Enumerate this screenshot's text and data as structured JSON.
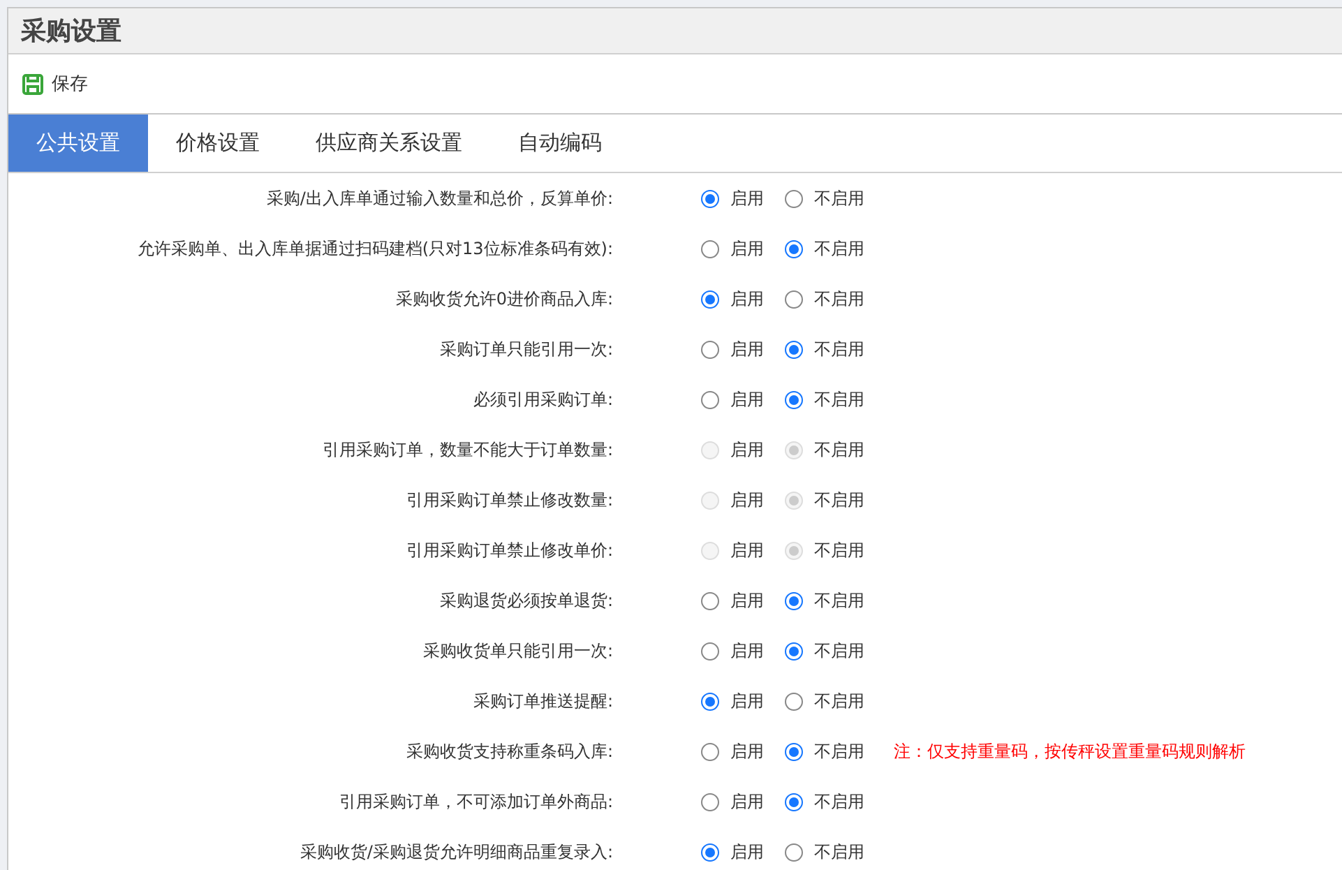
{
  "page": {
    "title": "采购设置"
  },
  "toolbar": {
    "save_label": "保存"
  },
  "tabs": [
    {
      "label": "公共设置",
      "selected": true
    },
    {
      "label": "价格设置",
      "selected": false
    },
    {
      "label": "供应商关系设置",
      "selected": false
    },
    {
      "label": "自动编码",
      "selected": false
    }
  ],
  "settings": [
    {
      "label": "采购/出入库单通过输入数量和总价，反算单价:",
      "disabled": false,
      "options": [
        {
          "label": "启用",
          "selected": true
        },
        {
          "label": "不启用",
          "selected": false
        }
      ]
    },
    {
      "label": "允许采购单、出入库单据通过扫码建档(只对13位标准条码有效):",
      "disabled": false,
      "options": [
        {
          "label": "启用",
          "selected": false
        },
        {
          "label": "不启用",
          "selected": true
        }
      ]
    },
    {
      "label": "采购收货允许0进价商品入库:",
      "disabled": false,
      "options": [
        {
          "label": "启用",
          "selected": true
        },
        {
          "label": "不启用",
          "selected": false
        }
      ]
    },
    {
      "label": "采购订单只能引用一次:",
      "disabled": false,
      "options": [
        {
          "label": "启用",
          "selected": false
        },
        {
          "label": "不启用",
          "selected": true
        }
      ]
    },
    {
      "label": "必须引用采购订单:",
      "disabled": false,
      "options": [
        {
          "label": "启用",
          "selected": false
        },
        {
          "label": "不启用",
          "selected": true
        }
      ]
    },
    {
      "label": "引用采购订单，数量不能大于订单数量:",
      "disabled": true,
      "options": [
        {
          "label": "启用",
          "selected": false
        },
        {
          "label": "不启用",
          "selected": true
        }
      ]
    },
    {
      "label": "引用采购订单禁止修改数量:",
      "disabled": true,
      "options": [
        {
          "label": "启用",
          "selected": false
        },
        {
          "label": "不启用",
          "selected": true
        }
      ]
    },
    {
      "label": "引用采购订单禁止修改单价:",
      "disabled": true,
      "options": [
        {
          "label": "启用",
          "selected": false
        },
        {
          "label": "不启用",
          "selected": true
        }
      ]
    },
    {
      "label": "采购退货必须按单退货:",
      "disabled": false,
      "options": [
        {
          "label": "启用",
          "selected": false
        },
        {
          "label": "不启用",
          "selected": true
        }
      ]
    },
    {
      "label": "采购收货单只能引用一次:",
      "disabled": false,
      "options": [
        {
          "label": "启用",
          "selected": false
        },
        {
          "label": "不启用",
          "selected": true
        }
      ]
    },
    {
      "label": "采购订单推送提醒:",
      "disabled": false,
      "options": [
        {
          "label": "启用",
          "selected": true
        },
        {
          "label": "不启用",
          "selected": false
        }
      ]
    },
    {
      "label": "采购收货支持称重条码入库:",
      "disabled": false,
      "options": [
        {
          "label": "启用",
          "selected": false
        },
        {
          "label": "不启用",
          "selected": true
        }
      ],
      "note": "注：仅支持重量码，按传秤设置重量码规则解析"
    },
    {
      "label": "引用采购订单，不可添加订单外商品:",
      "disabled": false,
      "options": [
        {
          "label": "启用",
          "selected": false
        },
        {
          "label": "不启用",
          "selected": true
        }
      ]
    },
    {
      "label": "采购收货/采购退货允许明细商品重复录入:",
      "disabled": false,
      "options": [
        {
          "label": "启用",
          "selected": true
        },
        {
          "label": "不启用",
          "selected": false
        }
      ]
    }
  ]
}
